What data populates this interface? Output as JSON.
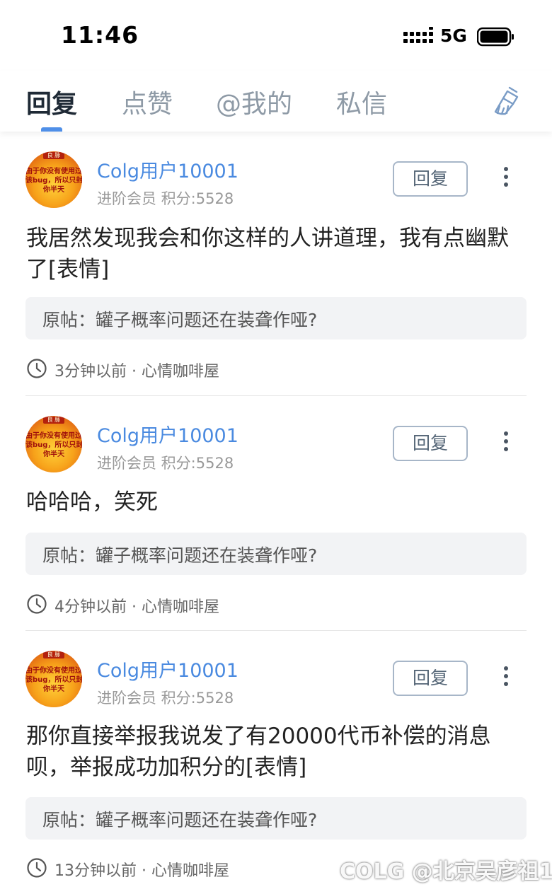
{
  "status_bar": {
    "time": "11:46",
    "network": "5G"
  },
  "tabs": [
    {
      "label": "回复",
      "active": true
    },
    {
      "label": "点赞",
      "active": false
    },
    {
      "label": "@我的",
      "active": false
    },
    {
      "label": "私信",
      "active": false
    }
  ],
  "items": [
    {
      "username": "Colg用户10001",
      "meta": "进阶会员 积分:5528",
      "reply_label": "回复",
      "content": "我居然发现我会和你这样的人讲道理，我有点幽默了[表情]",
      "quote": "原帖：罐子概率问题还在装聋作哑?",
      "time_forum": "3分钟以前 · 心情咖啡屋"
    },
    {
      "username": "Colg用户10001",
      "meta": "进阶会员 积分:5528",
      "reply_label": "回复",
      "content": "哈哈哈，笑死",
      "quote": "原帖：罐子概率问题还在装聋作哑?",
      "time_forum": "4分钟以前 · 心情咖啡屋"
    },
    {
      "username": "Colg用户10001",
      "meta": "进阶会员 积分:5528",
      "reply_label": "回复",
      "content": "那你直接举报我说发了有20000代币补偿的消息呗，举报成功加积分的[表情]",
      "quote": "原帖：罐子概率问题还在装聋作哑?",
      "time_forum": "13分钟以前 · 心情咖啡屋"
    }
  ],
  "avatar": {
    "badge": "良 脉",
    "lines": [
      "由于你没有使用过",
      "该bug，所以只封",
      "你半天"
    ]
  },
  "watermark": "COLG @北京吴彦祖1",
  "colors": {
    "accent": "#4f8fe8",
    "username": "#4a8ae0",
    "quote_bg": "#f2f3f5"
  },
  "icons": [
    "signal-icon",
    "battery-icon",
    "broom-clean-icon",
    "more-vertical-icon",
    "clock-icon"
  ]
}
